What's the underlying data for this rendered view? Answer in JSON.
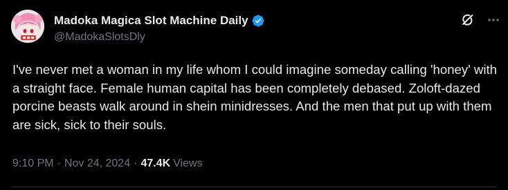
{
  "tweet": {
    "author": {
      "display_name": "Madoka Magica Slot Machine Daily",
      "handle": "@MadokaSlotsDly",
      "verified": true,
      "avatar_icon": "anime-girl-avatar"
    },
    "text": "I've never met a woman in my life whom I could imagine someday calling 'honey' with a straight face. Female human capital has been completely debased. Zoloft-dazed porcine beasts walk around in shein minidresses. And the men that put up with them are sick, sick to their souls.",
    "time": "9:10 PM",
    "separator": "·",
    "date": "Nov 24, 2024",
    "views_count": "47.4K",
    "views_label": "Views"
  },
  "icons": {
    "grok": "grok-icon",
    "more": "more-options-icon",
    "verified": "verified-badge-icon"
  },
  "colors": {
    "background": "#000000",
    "primary_text": "#e7e9ea",
    "secondary_text": "#71767b",
    "verified_blue": "#1d9bf0",
    "divider": "#2f3336"
  }
}
